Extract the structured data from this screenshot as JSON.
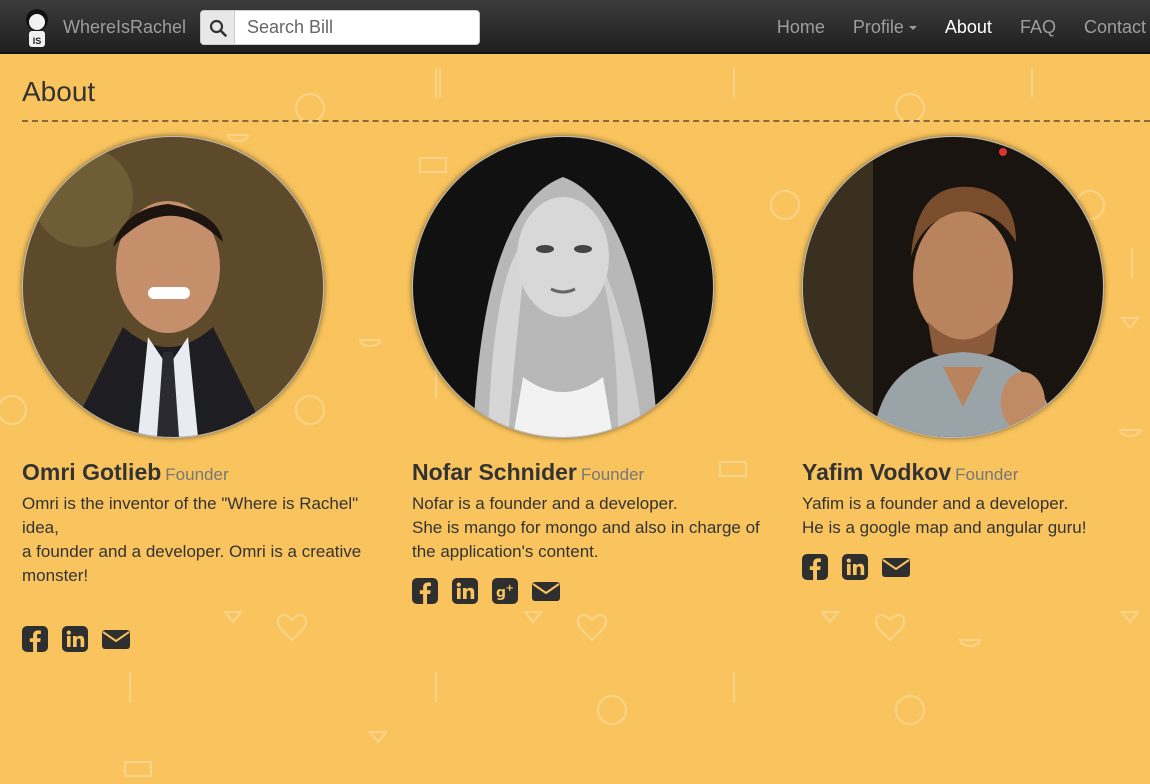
{
  "nav": {
    "brand": "WhereIsRachel",
    "search_placeholder": "Search Bill",
    "links": [
      {
        "label": "Home"
      },
      {
        "label": "Profile"
      },
      {
        "label": "About"
      },
      {
        "label": "FAQ"
      },
      {
        "label": "Contact"
      }
    ]
  },
  "page": {
    "title": "About"
  },
  "founders": [
    {
      "name": "Omri Gotlieb",
      "role": "Founder",
      "bio": [
        "Omri is the inventor of the \"Where is Rachel\" idea,",
        "a founder and a developer. Omri is a creative monster!"
      ],
      "socials": [
        "facebook-icon",
        "linkedin-icon",
        "envelope-icon"
      ]
    },
    {
      "name": "Nofar Schnider",
      "role": "Founder",
      "bio": [
        "Nofar is a founder and a developer.",
        "She is mango for mongo and also in charge of the application's content."
      ],
      "socials": [
        "facebook-icon",
        "linkedin-icon",
        "google-plus-icon",
        "envelope-icon"
      ]
    },
    {
      "name": "Yafim Vodkov",
      "role": "Founder",
      "bio": [
        "Yafim is a founder and a developer.",
        "He is a google map and angular guru!"
      ],
      "socials": [
        "facebook-icon",
        "linkedin-icon",
        "envelope-icon"
      ]
    }
  ],
  "colors": {
    "background": "#f9c45e",
    "navbar": "#2a2a2a",
    "text": "#333333"
  }
}
